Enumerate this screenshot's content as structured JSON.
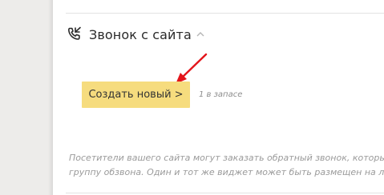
{
  "section": {
    "title": "Звонок с сайта",
    "icon": "phone-callback-icon",
    "toggle_icon": "chevron-up-icon"
  },
  "actions": {
    "create_label": "Создать новый >",
    "stock_note": "1 в запасе",
    "button_color": "#f6dc7e",
    "annotation_color": "#e3151b"
  },
  "description": {
    "line1": "Посетители вашего сайта могут заказать обратный звонок, которы",
    "line2": "группу обзвона. Один и тот же виджет может быть размещен на люб"
  }
}
